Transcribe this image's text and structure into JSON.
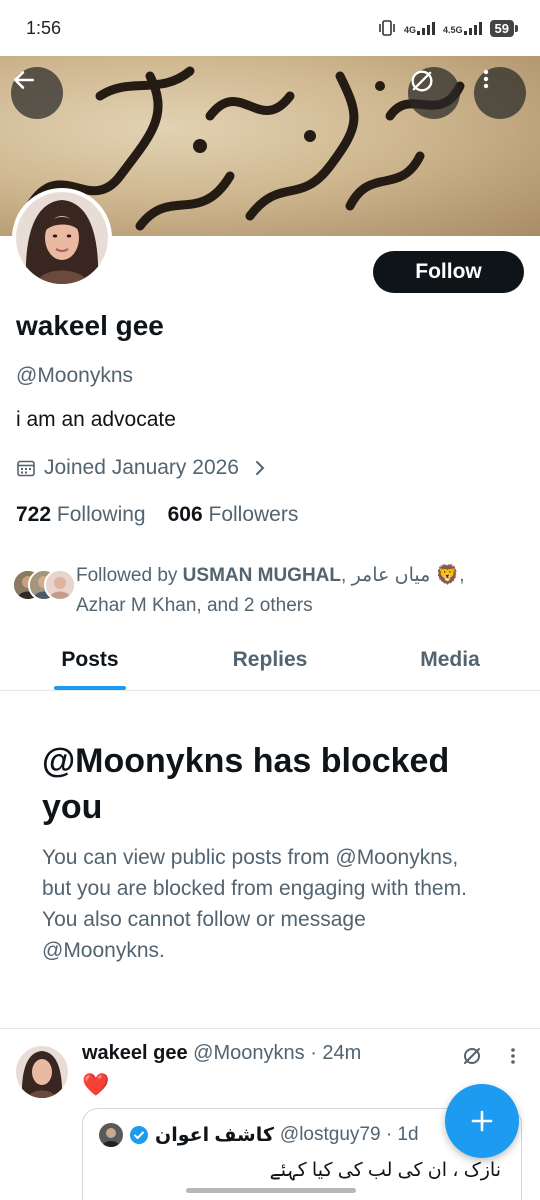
{
  "status_bar": {
    "time": "1:56",
    "net1": "4G",
    "net2": "4.5G",
    "battery": "59"
  },
  "header": {
    "back_icon": "back-arrow-icon",
    "repost_icon": "sync-off-icon",
    "more_icon": "more-vertical-icon"
  },
  "profile": {
    "follow_label": "Follow",
    "display_name": "wakeel gee",
    "handle": "@Moonykns",
    "bio": "i am an advocate",
    "joined": "Joined January 2026",
    "following_count": "722",
    "following_label": "Following",
    "followers_count": "606",
    "followers_label": "Followers",
    "followed_by_prefix": "Followed by ",
    "followed_by_name": "USMAN MUGHAL",
    "followed_by_rest": ", میاں عامر 🦁,",
    "followed_by_line2": "Azhar M Khan, and 2 others"
  },
  "tabs": [
    {
      "label": "Posts"
    },
    {
      "label": "Replies"
    },
    {
      "label": "Media"
    }
  ],
  "blocked": {
    "title": "@Moonykns has blocked you",
    "description": "You can view public posts from @Moonykns, but you are blocked from engaging with them. You also cannot follow or message @Moonykns."
  },
  "tweet": {
    "name": "wakeel gee",
    "meta": " @Moonykns · 24m",
    "text": "❤️",
    "quote": {
      "name": "کاشف اعوان",
      "meta": "@lostguy79 · 1d",
      "text": "نازک ، ان کی لب کی کیا کہئے"
    }
  },
  "colors": {
    "accent": "#1d9bf0",
    "text_primary": "#0f1419",
    "text_secondary": "#536471",
    "follow_button": "#0f1419"
  }
}
